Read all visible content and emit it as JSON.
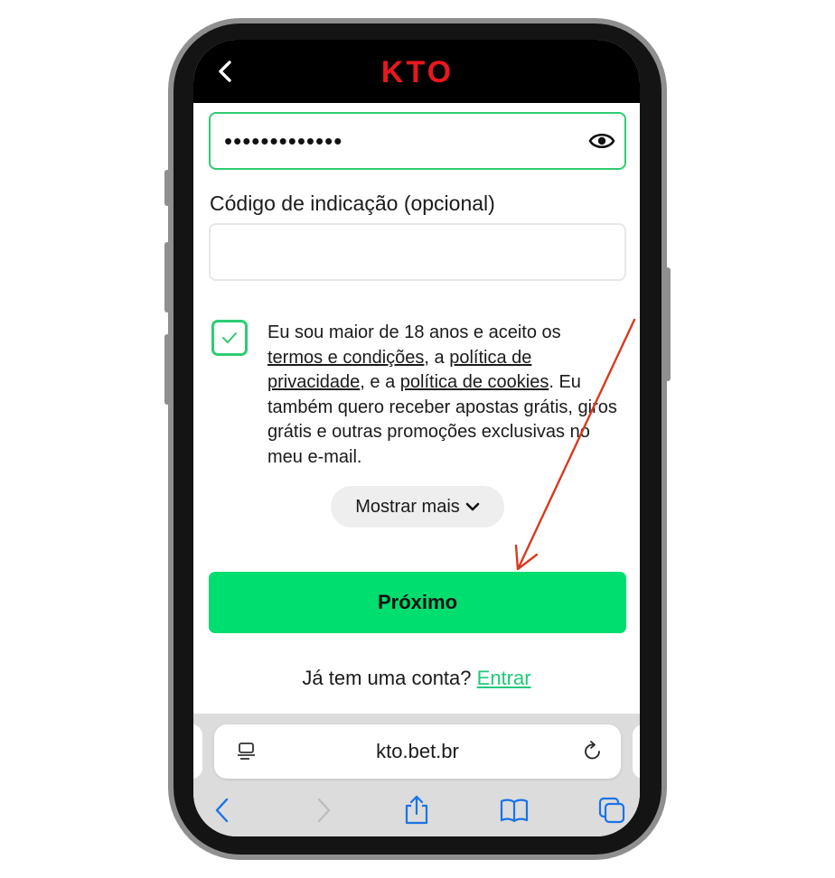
{
  "app": {
    "brand": "KTO",
    "brand_color": "#e8181e",
    "accent_color": "#00de70",
    "back_icon": "chevron-left-icon"
  },
  "form": {
    "password_value": "•••••••••••••",
    "password_toggle_icon": "eye-icon",
    "referral_label": "Código de indicação (opcional)",
    "referral_value": "",
    "consent_checked": true,
    "consent_text_1": "Eu sou maior de 18 anos e aceito os ",
    "terms_link": "termos e condições",
    "consent_text_2": ", a ",
    "privacy_link": "política de privacidade",
    "consent_text_3": ", e a ",
    "cookies_link": "política de cookies",
    "consent_text_4": ". Eu também quero receber apostas grátis, giros grátis e outras promoções exclusivas no meu e-mail.",
    "show_more_label": "Mostrar mais",
    "next_button": "Próximo",
    "login_prompt": "Já tem uma conta? ",
    "login_link": "Entrar"
  },
  "browser": {
    "url": "kto.bet.br",
    "toolbar_icons": [
      "back-icon",
      "forward-icon",
      "share-icon",
      "bookmarks-icon",
      "tabs-icon"
    ],
    "tint_color": "#1a73e8"
  },
  "annotation": {
    "arrow_color": "#d9391f"
  }
}
